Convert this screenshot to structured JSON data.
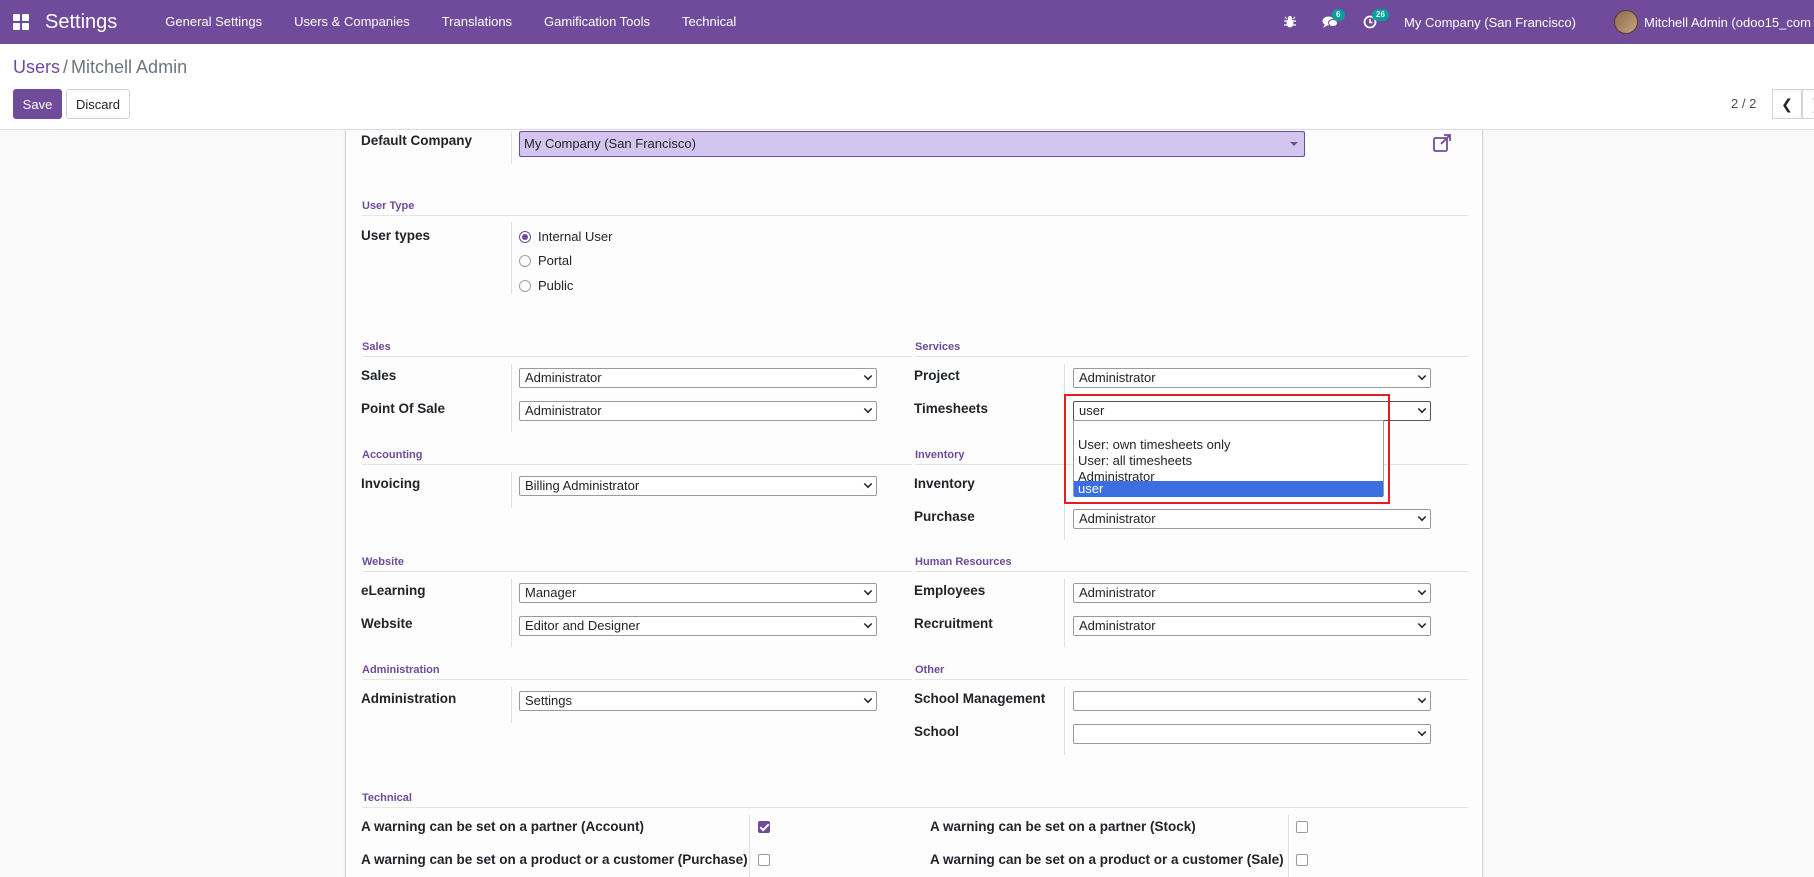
{
  "navbar": {
    "app_title": "Settings",
    "menu": [
      "General Settings",
      "Users & Companies",
      "Translations",
      "Gamification Tools",
      "Technical"
    ],
    "chat_badge": "6",
    "activity_badge": "26",
    "company": "My Company (San Francisco)",
    "user": "Mitchell Admin (odoo15_com"
  },
  "breadcrumb": {
    "parent": "Users",
    "separator": "/",
    "current": "Mitchell Admin"
  },
  "buttons": {
    "save": "Save",
    "discard": "Discard"
  },
  "pager": {
    "value": "2 / 2"
  },
  "form": {
    "default_company_label": "Default Company",
    "default_company_value": "My Company (San Francisco)",
    "user_type_section": "User Type",
    "user_types_label": "User types",
    "user_type_options": [
      "Internal User",
      "Portal",
      "Public"
    ],
    "user_type_selected": "Internal User",
    "sections": {
      "sales": "Sales",
      "services": "Services",
      "accounting": "Accounting",
      "inventory": "Inventory",
      "website": "Website",
      "human_resources": "Human Resources",
      "administration": "Administration",
      "other": "Other",
      "technical": "Technical"
    },
    "fields": {
      "sales": {
        "label": "Sales",
        "value": "Administrator"
      },
      "point_of_sale": {
        "label": "Point Of Sale",
        "value": "Administrator"
      },
      "project": {
        "label": "Project",
        "value": "Administrator"
      },
      "timesheets": {
        "label": "Timesheets",
        "value": "user"
      },
      "invoicing": {
        "label": "Invoicing",
        "value": "Billing Administrator"
      },
      "inventory": {
        "label": "Inventory",
        "value": ""
      },
      "purchase": {
        "label": "Purchase",
        "value": "Administrator"
      },
      "elearning": {
        "label": "eLearning",
        "value": "Manager"
      },
      "website": {
        "label": "Website",
        "value": "Editor and Designer"
      },
      "employees": {
        "label": "Employees",
        "value": "Administrator"
      },
      "recruitment": {
        "label": "Recruitment",
        "value": "Administrator"
      },
      "administration": {
        "label": "Administration",
        "value": "Settings"
      },
      "school_management": {
        "label": "School Management",
        "value": ""
      },
      "school": {
        "label": "School",
        "value": ""
      }
    },
    "timesheets_dropdown": {
      "options": [
        "",
        "User: own timesheets only",
        "User: all timesheets",
        "Administrator",
        "user"
      ],
      "selected": "user"
    },
    "technical": [
      {
        "label": "A warning can be set on a partner (Account)",
        "checked": true
      },
      {
        "label": "A warning can be set on a partner (Stock)",
        "checked": false
      },
      {
        "label": "A warning can be set on a product or a customer (Purchase)",
        "checked": false
      },
      {
        "label": "A warning can be set on a product or a customer (Sale)",
        "checked": false
      }
    ]
  },
  "colors": {
    "brand": "#714b9b",
    "badge": "#00a09d",
    "highlight": "#e02020",
    "selected_option": "#3b6ee0"
  }
}
